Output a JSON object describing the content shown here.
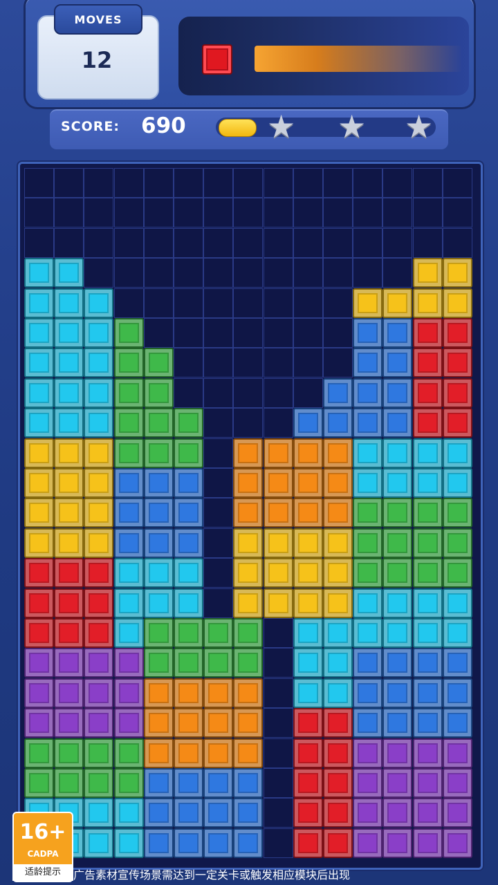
{
  "hud": {
    "moves_label": "MOVES",
    "moves_value": "12",
    "target_color": "red",
    "target_progress": 0.9,
    "score_label": "SCORE:",
    "score_value": "690",
    "score_progress": 0.17,
    "stars_total": 3,
    "stars_earned": 0
  },
  "board": {
    "cols": 15,
    "rows": 23,
    "legend": {
      "0": "empty",
      "C": "cyan",
      "G": "green",
      "B": "blue",
      "Y": "yellow",
      "R": "red",
      "O": "orange",
      "P": "purple"
    },
    "colors": {
      "C": "#22c8ee",
      "G": "#3fb94a",
      "B": "#2f78e0",
      "Y": "#f6c21a",
      "R": "#e21e28",
      "O": "#f58a16",
      "P": "#8a3fc8"
    },
    "grid": [
      "000000000000000",
      "000000000000000",
      "000000000000000",
      "CC00000000000YYY",
      "CCC00000000YYYY",
      "CCCG0000000BBRRR",
      "CCCGG000000BBRRR",
      "CCCGG00000BBBRRR",
      "CCCGGG000BBBBRRR",
      "YYYGGG0OOOOCCCC",
      "YYYBBB0OOOOCCCC",
      "YYYBBB0OOOOGGGG",
      "YYYBBB0YYYYGGGG",
      "RRRCCC0YYYYGGGG",
      "RRRCCC0YYYYCCCC",
      "RRRCGGGG0CCCCCC",
      "PPPPGGGG0CCBBBB",
      "PPPPOOOO0CCBBBB",
      "PPPPOOOO0RRBBBB",
      "GGGGOOOO0RRPPPP",
      "GGGGBBBB0RRPPPP",
      "CCCCBBBB0RRPPPP",
      "CCCCBBBB0RRPPPP"
    ]
  },
  "rating": {
    "age": "16+",
    "org": "CADPA",
    "tip": "适龄提示"
  },
  "disclaimer": "广告素材宣传场景需达到一定关卡或触发相应模块后出现"
}
